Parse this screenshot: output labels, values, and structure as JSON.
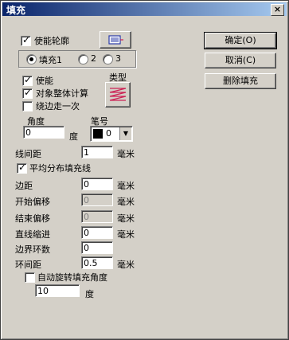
{
  "window": {
    "title": "填充",
    "close_glyph": "×"
  },
  "outline": {
    "label": "使能轮廓"
  },
  "fill_tabs": [
    {
      "label": "填充1"
    },
    {
      "label": "2"
    },
    {
      "label": "3"
    }
  ],
  "options": {
    "enable_label": "使能",
    "whole_calc_label": "对象整体计算",
    "edge_once_label": "绕边走一次",
    "type_label": "类型"
  },
  "angle": {
    "label": "角度",
    "value": "0",
    "unit": "度"
  },
  "pen": {
    "label": "笔号",
    "value": "0"
  },
  "line_spacing": {
    "label": "线间距",
    "value": "1",
    "unit": "毫米"
  },
  "even_distribute": {
    "label": "平均分布填充线"
  },
  "margin": {
    "label": "边距",
    "value": "0",
    "unit": "毫米"
  },
  "start_offset": {
    "label": "开始偏移",
    "value": "0",
    "unit": "毫米"
  },
  "end_offset": {
    "label": "结束偏移",
    "value": "0",
    "unit": "毫米"
  },
  "line_indent": {
    "label": "直线缩进",
    "value": "0",
    "unit": "毫米"
  },
  "boundary_rings": {
    "label": "边界环数",
    "value": "0"
  },
  "ring_spacing": {
    "label": "环间距",
    "value": "0.5",
    "unit": "毫米"
  },
  "auto_rotate": {
    "label": "自动旋转填充角度",
    "value": "10",
    "unit": "度"
  },
  "buttons": {
    "ok": "确定(O)",
    "cancel": "取消(C)",
    "delete_fill": "删除填充"
  },
  "colors": {
    "pen_swatch": "#000000",
    "hatch_icon": "#cc2255",
    "outline_icon": "#2a3aa8"
  }
}
